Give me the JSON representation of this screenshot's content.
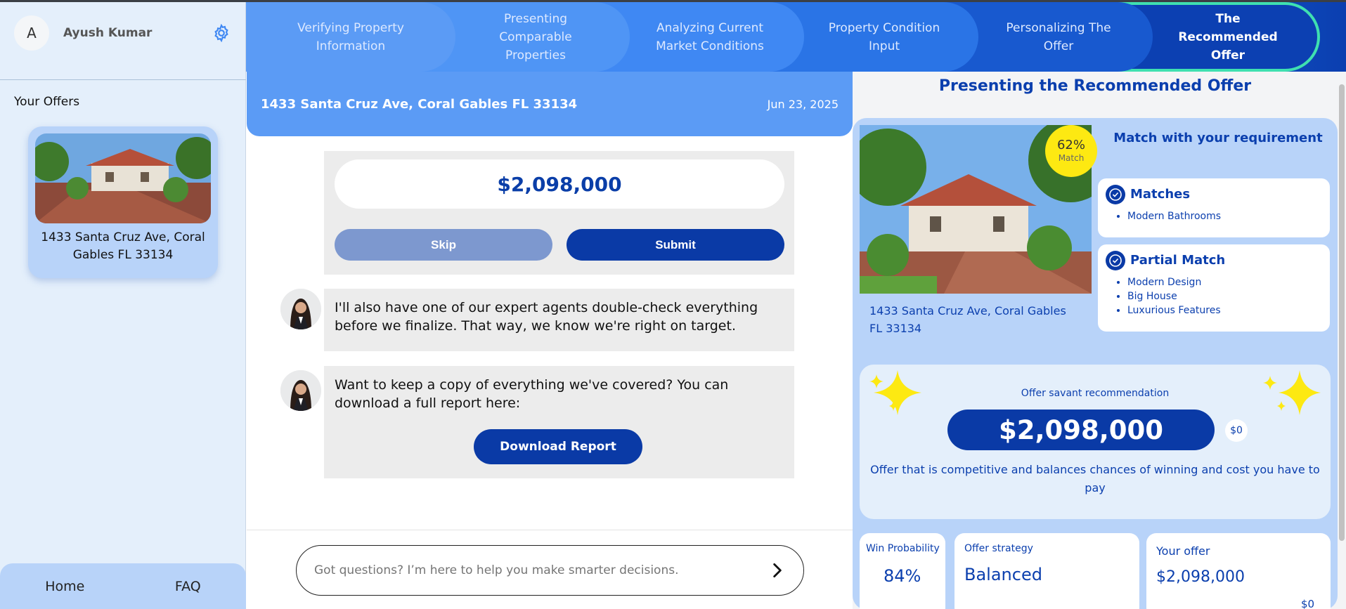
{
  "user": {
    "initial": "A",
    "name": "Ayush Kumar"
  },
  "sidebar": {
    "offers_title": "Your Offers",
    "offers": [
      {
        "address": "1433 Santa Cruz Ave, Coral Gables FL 33134"
      }
    ],
    "nav": {
      "home": "Home",
      "faq": "FAQ"
    }
  },
  "steps": [
    {
      "label": "Verifying Property Information",
      "state": "done"
    },
    {
      "label": "Presenting Comparable Properties",
      "state": "done"
    },
    {
      "label": "Analyzing Current Market Conditions",
      "state": "done"
    },
    {
      "label": "Property Condition Input",
      "state": "done"
    },
    {
      "label": "Personalizing The Offer",
      "state": "done"
    },
    {
      "label": "The Recommended Offer",
      "state": "active"
    }
  ],
  "chat": {
    "address": "1433 Santa Cruz Ave, Coral Gables FL 33134",
    "date": "Jun 23, 2025",
    "price_value": "$2,098,000",
    "skip_label": "Skip",
    "submit_label": "Submit",
    "messages": [
      {
        "text": "I'll also have one of our expert agents double-check everything before we finalize. That way, we know we're right on target."
      },
      {
        "text": "Want to keep a copy of everything we've covered? You can download a full report here:",
        "button": "Download Report"
      }
    ],
    "input_placeholder": "Got questions? I’m here to help you make smarter decisions."
  },
  "recommendation": {
    "title": "Presenting the Recommended Offer",
    "match_percent": "62%",
    "match_label": "Match",
    "address": "1433 Santa Cruz Ave, Coral Gables FL 33134",
    "requirement_title": "Match with your requirement",
    "matches": {
      "heading": "Matches",
      "items": [
        "Modern Bathrooms"
      ]
    },
    "partial": {
      "heading": "Partial Match",
      "items": [
        "Modern Design",
        "Big House",
        "Luxurious Features"
      ]
    },
    "savant_label": "Offer savant recommendation",
    "price": "$2,098,000",
    "delta": "$0",
    "description": "Offer that is competitive and balances chances of winning and cost you have to pay",
    "stats": {
      "win_label": "Win Probability",
      "win_value": "84%",
      "strategy_label": "Offer strategy",
      "strategy_value": "Balanced",
      "your_offer_label": "Your offer",
      "your_offer_value": "$2,098,000",
      "your_offer_delta": "$0"
    }
  },
  "colors": {
    "primary": "#0a3aa6",
    "accent": "#5b9bf5",
    "badge": "#fde912",
    "active_outline": "#3fe0b0"
  }
}
